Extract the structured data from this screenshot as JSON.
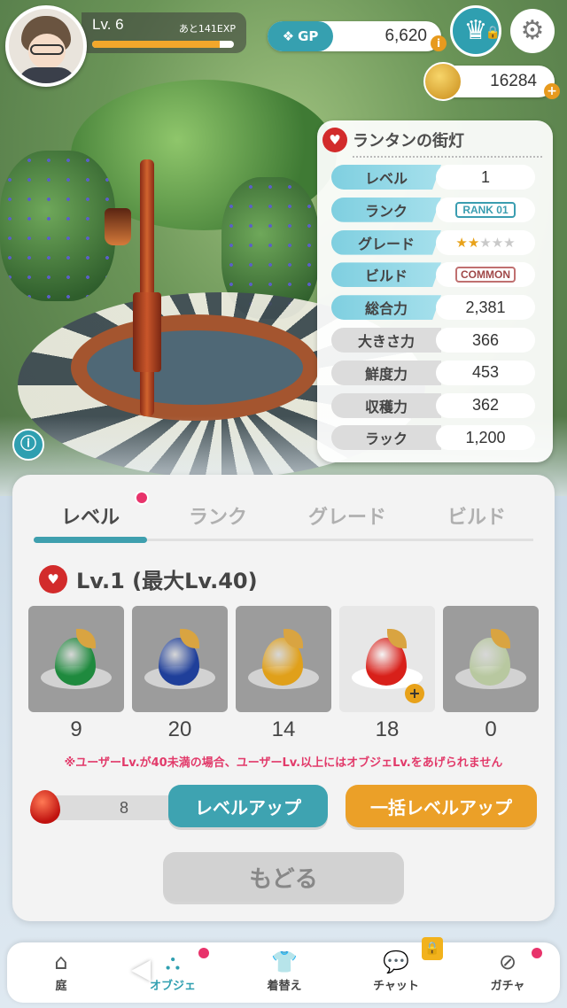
{
  "player": {
    "level": "Lv. 6",
    "exp_remaining": "あと141EXP",
    "exp_progress": 0.9
  },
  "currency": {
    "gp_label": "GP",
    "gp_value": "6,620",
    "gp_info": "i",
    "coins": "16284",
    "coins_plus": "+"
  },
  "object": {
    "name": "ランタンの街灯",
    "stats": [
      {
        "label": "レベル",
        "value": "1",
        "style": "teal"
      },
      {
        "label": "ランク",
        "value": "RANK 01",
        "style": "teal",
        "badge": "rank"
      },
      {
        "label": "グレード",
        "value": "",
        "style": "teal",
        "stars_on": 2,
        "stars_total": 5
      },
      {
        "label": "ビルド",
        "value": "COMMON",
        "style": "teal",
        "badge": "common"
      },
      {
        "label": "総合力",
        "value": "2,381",
        "style": "teal"
      },
      {
        "label": "大きさ力",
        "value": "366",
        "style": "gray"
      },
      {
        "label": "鮮度力",
        "value": "453",
        "style": "gray"
      },
      {
        "label": "収穫力",
        "value": "362",
        "style": "gray"
      },
      {
        "label": "ラック",
        "value": "1,200",
        "style": "gray"
      }
    ]
  },
  "tabs": [
    {
      "label": "レベル",
      "active": true
    },
    {
      "label": "ランク",
      "active": false
    },
    {
      "label": "グレード",
      "active": false
    },
    {
      "label": "ビルド",
      "active": false
    }
  ],
  "level_panel": {
    "heading": "Lv.1 (最大Lv.40)",
    "items": [
      {
        "count": "9",
        "color": "#1f8a3e"
      },
      {
        "count": "20",
        "color": "#1f3f9a"
      },
      {
        "count": "14",
        "color": "#e0a01a"
      },
      {
        "count": "18",
        "color": "#d8201a",
        "selected": true
      },
      {
        "count": "0",
        "color": "#b8c8a0"
      }
    ],
    "notice": "※ユーザーLv.が40未満の場合、ユーザーLv.以上にはオブジェLv.をあげられません",
    "quantity": "8",
    "level_up_label": "レベルアップ",
    "bulk_level_up_label": "一括レベルアップ",
    "back_label": "もどる"
  },
  "nav": [
    {
      "label": "庭",
      "icon": "home-icon",
      "glyph": "⌂"
    },
    {
      "label": "オブジェ",
      "icon": "object-icon",
      "glyph": "⛬",
      "active": true
    },
    {
      "label": "着替え",
      "icon": "clothes-icon",
      "glyph": "👕"
    },
    {
      "label": "チャット",
      "icon": "chat-icon",
      "glyph": "💬"
    },
    {
      "label": "ガチャ",
      "icon": "gacha-icon",
      "glyph": "⊘"
    }
  ]
}
